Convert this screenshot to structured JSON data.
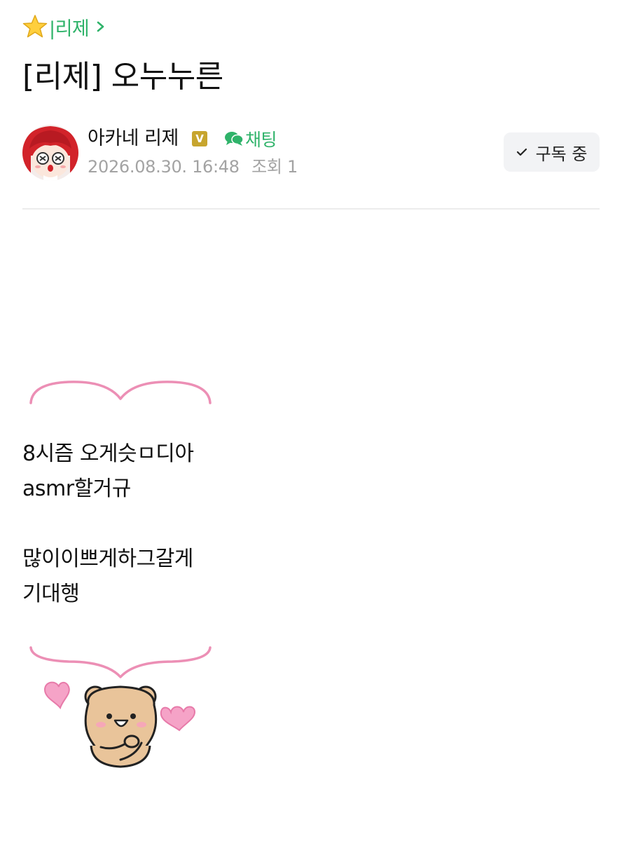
{
  "breadcrumb": {
    "star_icon": "star-icon",
    "board_label": "|리제",
    "chevron_icon": "chevron-right-icon"
  },
  "post": {
    "title": "[리제] 오누누른"
  },
  "author": {
    "name": "아카네 리제",
    "badge": "V",
    "chat_label": "채팅",
    "chat_icon": "speech-bubble-icon",
    "date": "2026.08.30. 16:48",
    "views_label": "조회 1"
  },
  "subscribe": {
    "label": "구독 중",
    "check_icon": "checkmark-icon"
  },
  "body": {
    "lines": [
      "8시즘 오게슷ㅁ디아",
      "asmr할거규",
      "",
      "많이이쁘게하그갈게",
      "기대행"
    ]
  },
  "colors": {
    "accent_green": "#2fb36a",
    "badge_gold": "#c7a52e",
    "meta_gray": "#a3a3a3",
    "deco_pink": "#ec8fb5",
    "button_bg": "#f2f3f5"
  }
}
